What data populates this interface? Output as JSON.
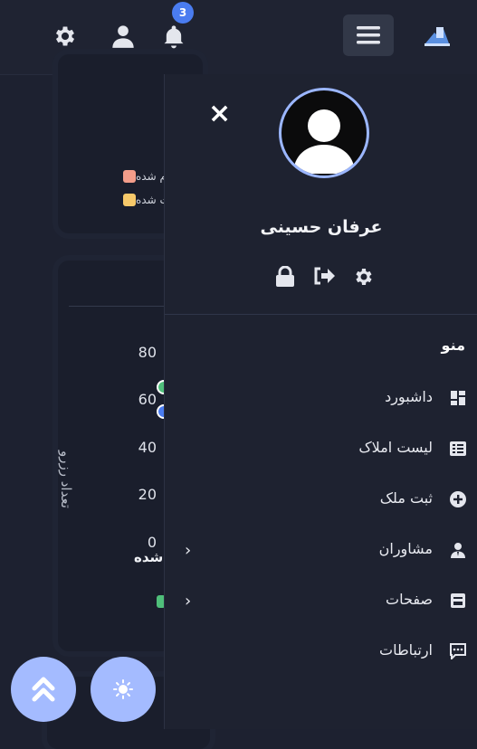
{
  "header": {
    "notification_count": "3",
    "icons": [
      "gear-icon",
      "user-icon",
      "bell-icon",
      "hamburger-icon",
      "logo"
    ]
  },
  "background": {
    "legend": [
      {
        "label": "م شده",
        "color": "#f39d8a"
      },
      {
        "label": "ت شده",
        "color": "#f7c96a"
      }
    ],
    "chart": {
      "y_label": "تعداد رزرو",
      "y_ticks": [
        "80",
        "60",
        "40",
        "20",
        "0"
      ],
      "x_label_fragment": "شده"
    }
  },
  "drawer": {
    "close_symbol": "×",
    "user_name": "عرفان حسینی",
    "menu_title": "منو",
    "items": [
      {
        "label": "داشبورد",
        "icon": "dashboard-icon",
        "has_submenu": false
      },
      {
        "label": "لیست املاک",
        "icon": "list-icon",
        "has_submenu": false
      },
      {
        "label": "ثبت ملک",
        "icon": "plus-circle-icon",
        "has_submenu": false
      },
      {
        "label": "مشاوران",
        "icon": "agent-icon",
        "has_submenu": true
      },
      {
        "label": "صفحات",
        "icon": "pages-icon",
        "has_submenu": true
      },
      {
        "label": "ارتباطات",
        "icon": "chat-icon",
        "has_submenu": false
      }
    ],
    "chevron": "‹"
  },
  "colors": {
    "accent": "#4a7cf0",
    "fab": "#a4bbff",
    "avatar_ring": "#9bb6ff",
    "drawer_bg": "#1e2230"
  }
}
